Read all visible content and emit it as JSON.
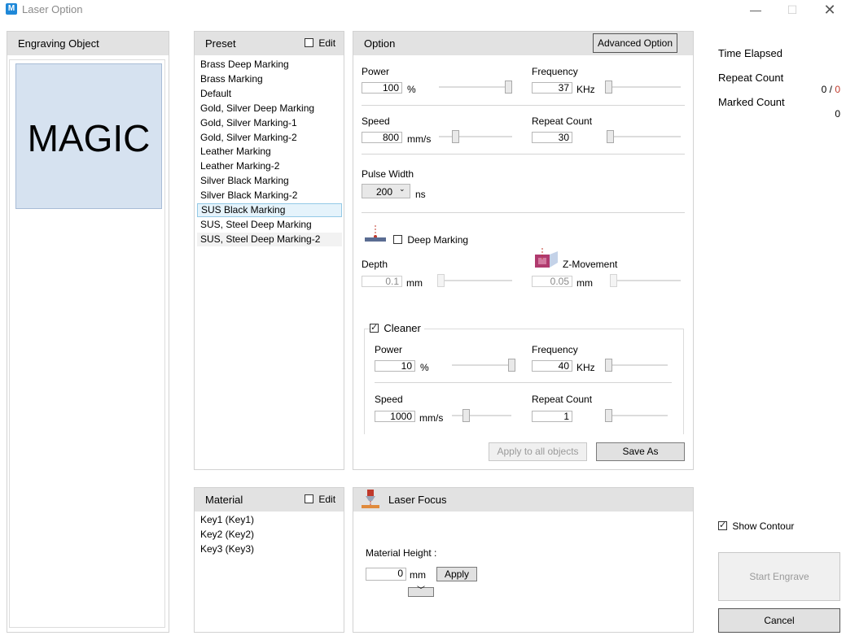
{
  "window": {
    "title": "Laser Option",
    "app_icon": "M"
  },
  "engraving": {
    "header": "Engraving Object",
    "preview_text": "MAGIC"
  },
  "preset": {
    "header": "Preset",
    "edit_label": "Edit",
    "edit_checked": false,
    "items": [
      "Brass Deep Marking",
      "Brass Marking",
      "Default",
      "Gold, Silver Deep Marking",
      "Gold, Silver Marking-1",
      "Gold, Silver Marking-2",
      "Leather Marking",
      "Leather Marking-2",
      "Silver Black Marking",
      "Silver Black Marking-2",
      "SUS Black Marking",
      "SUS, Steel Deep Marking",
      "SUS, Steel Deep Marking-2"
    ],
    "selected": "SUS Black Marking"
  },
  "option": {
    "header": "Option",
    "advanced_button": "Advanced Option",
    "power": {
      "label": "Power",
      "value": "100",
      "unit": "%",
      "level": 1.0
    },
    "frequency": {
      "label": "Frequency",
      "value": "37",
      "unit": "KHz",
      "level": 0.0
    },
    "speed": {
      "label": "Speed",
      "value": "800",
      "unit": "mm/s",
      "level": 0.2
    },
    "repeat": {
      "label": "Repeat Count",
      "value": "30",
      "level": 0.0
    },
    "pulse_width": {
      "label": "Pulse Width",
      "value": "200",
      "unit": "ns"
    },
    "deep_marking": {
      "label": "Deep Marking",
      "checked": false
    },
    "depth": {
      "label": "Depth",
      "value": "0.1",
      "unit": "mm",
      "level": 0.0
    },
    "z_movement": {
      "label": "Z-Movement",
      "value": "0.05",
      "unit": "mm",
      "level": 0.0
    },
    "cleaner": {
      "label": "Cleaner",
      "checked": true,
      "power": {
        "label": "Power",
        "value": "10",
        "unit": "%",
        "level": 1.0
      },
      "frequency": {
        "label": "Frequency",
        "value": "40",
        "unit": "KHz",
        "level": 0.0
      },
      "speed": {
        "label": "Speed",
        "value": "1000",
        "unit": "mm/s",
        "level": 0.2
      },
      "repeat": {
        "label": "Repeat Count",
        "value": "1",
        "level": 0.0
      }
    },
    "apply_all_button": "Apply to all objects",
    "save_as_button": "Save As"
  },
  "status": {
    "time_elapsed_label": "Time Elapsed",
    "repeat_count_label": "Repeat Count",
    "repeat_done": "0",
    "repeat_sep": " / ",
    "repeat_total": "0",
    "marked_count_label": "Marked Count",
    "marked_value": "0"
  },
  "material": {
    "header": "Material",
    "edit_label": "Edit",
    "edit_checked": false,
    "items": [
      "Key1  (Key1)",
      "Key2  (Key2)",
      "Key3  (Key3)"
    ]
  },
  "laser_focus": {
    "header": "Laser Focus",
    "height_label": "Material Height :",
    "height_value": "0",
    "unit": "mm",
    "apply_button": "Apply",
    "expand_icon": "double-chevron-down-icon"
  },
  "show_contour": {
    "label": "Show Contour",
    "checked": true
  },
  "start_button": "Start Engrave",
  "cancel_button": "Cancel",
  "colors": {
    "accent_red": "#c0392b",
    "header_gray": "#e2e2e2",
    "preview_bg": "#d6e2f0"
  }
}
